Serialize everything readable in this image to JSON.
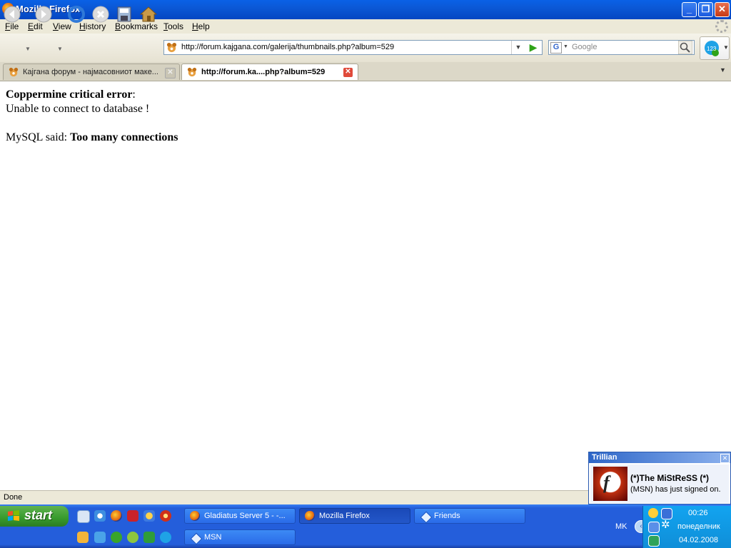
{
  "window": {
    "title": "Mozilla Firefox"
  },
  "menu": [
    {
      "label": "File",
      "key": "F",
      "rest": "ile"
    },
    {
      "label": "Edit",
      "key": "E",
      "rest": "dit"
    },
    {
      "label": "View",
      "key": "V",
      "rest": "iew"
    },
    {
      "label": "History",
      "key": "H",
      "rest": "istory"
    },
    {
      "label": "Bookmarks",
      "key": "B",
      "rest": "ookmarks"
    },
    {
      "label": "Tools",
      "key": "T",
      "rest": "ools"
    },
    {
      "label": "Help",
      "key": "H",
      "rest": "elp"
    }
  ],
  "toolbar": {
    "url": "http://forum.kajgana.com/galerija/thumbnails.php?album=529",
    "search_engine": "G",
    "search_placeholder": "Google"
  },
  "tabs": [
    {
      "label": "Кајгана форум - најмасовниот маке...",
      "active": false
    },
    {
      "label": "http://forum.ka....php?album=529",
      "active": true
    }
  ],
  "content": {
    "error_title": "Coppermine critical error",
    "error_colon": ":",
    "error_message": "Unable to connect to database !",
    "mysql_prefix": "MySQL said: ",
    "mysql_error": "Too many connections"
  },
  "status": {
    "text": "Done"
  },
  "trillian": {
    "title": "Trillian",
    "contact": "(*)The MiStReSS (*)",
    "message": "(MSN) has just signed on."
  },
  "taskbar": {
    "start_label": "start",
    "buttons": [
      {
        "label": "Gladiatus Server 5 - -...",
        "active": false
      },
      {
        "label": "Mozilla Firefox",
        "active": true
      },
      {
        "label": "Friends",
        "active": false
      },
      {
        "label": "MSN",
        "active": false
      }
    ],
    "language": "MK",
    "clock_time": "00:26",
    "clock_day": "понеделник",
    "clock_date": "04.02.2008"
  }
}
